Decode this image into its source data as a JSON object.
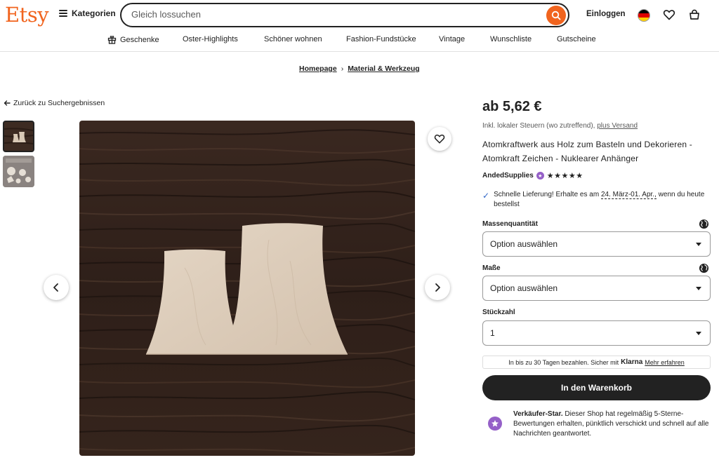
{
  "header": {
    "logo": "Etsy",
    "categories_label": "Kategorien",
    "search_placeholder": "Gleich lossuchen",
    "login_label": "Einloggen",
    "colors": {
      "brand": "#f1641e"
    }
  },
  "nav": {
    "items": [
      {
        "label": "Geschenke",
        "icon": "gift-icon"
      },
      {
        "label": "Oster-Highlights"
      },
      {
        "label": "Schöner wohnen"
      },
      {
        "label": "Fashion-Fundstücke"
      },
      {
        "label": "Vintage"
      },
      {
        "label": "Wunschliste"
      },
      {
        "label": "Gutscheine"
      }
    ]
  },
  "breadcrumb": {
    "items": [
      "Homepage",
      "Material & Werkzeug"
    ],
    "separator": "›"
  },
  "back_link": "Zurück zu Suchergebnissen",
  "product": {
    "price": "ab 5,62 €",
    "tax_note": "Inkl. lokaler Steuern (wo zutreffend),",
    "shipping_link": "plus Versand",
    "title": "Atomkraftwerk aus Holz zum Basteln und Dekorieren - Atomkraft Zeichen - Nuklearer Anhänger",
    "seller": "AndedSupplies",
    "rating_stars": 5,
    "stars_text": "★★★★★",
    "delivery_prefix": "Schnelle Lieferung! Erhalte es am",
    "delivery_dates": "24. März-01. Apr.,",
    "delivery_suffix": "wenn du heute bestellst"
  },
  "options": {
    "bulk_label": "Massenquantität",
    "bulk_value": "Option auswählen",
    "size_label": "Maße",
    "size_value": "Option auswählen",
    "qty_label": "Stückzahl",
    "qty_value": "1"
  },
  "klarna": {
    "text": "In bis zu 30 Tagen bezahlen. Sicher mit",
    "brand": "Klarna",
    "link": "Mehr erfahren"
  },
  "cart_button": "In den Warenkorb",
  "star_seller": {
    "title": "Verkäufer-Star.",
    "text": "Dieser Shop hat regelmäßig 5-Sterne-Bewertungen erhalten, pünktlich verschickt und schnell auf alle Nachrichten geantwortet."
  }
}
